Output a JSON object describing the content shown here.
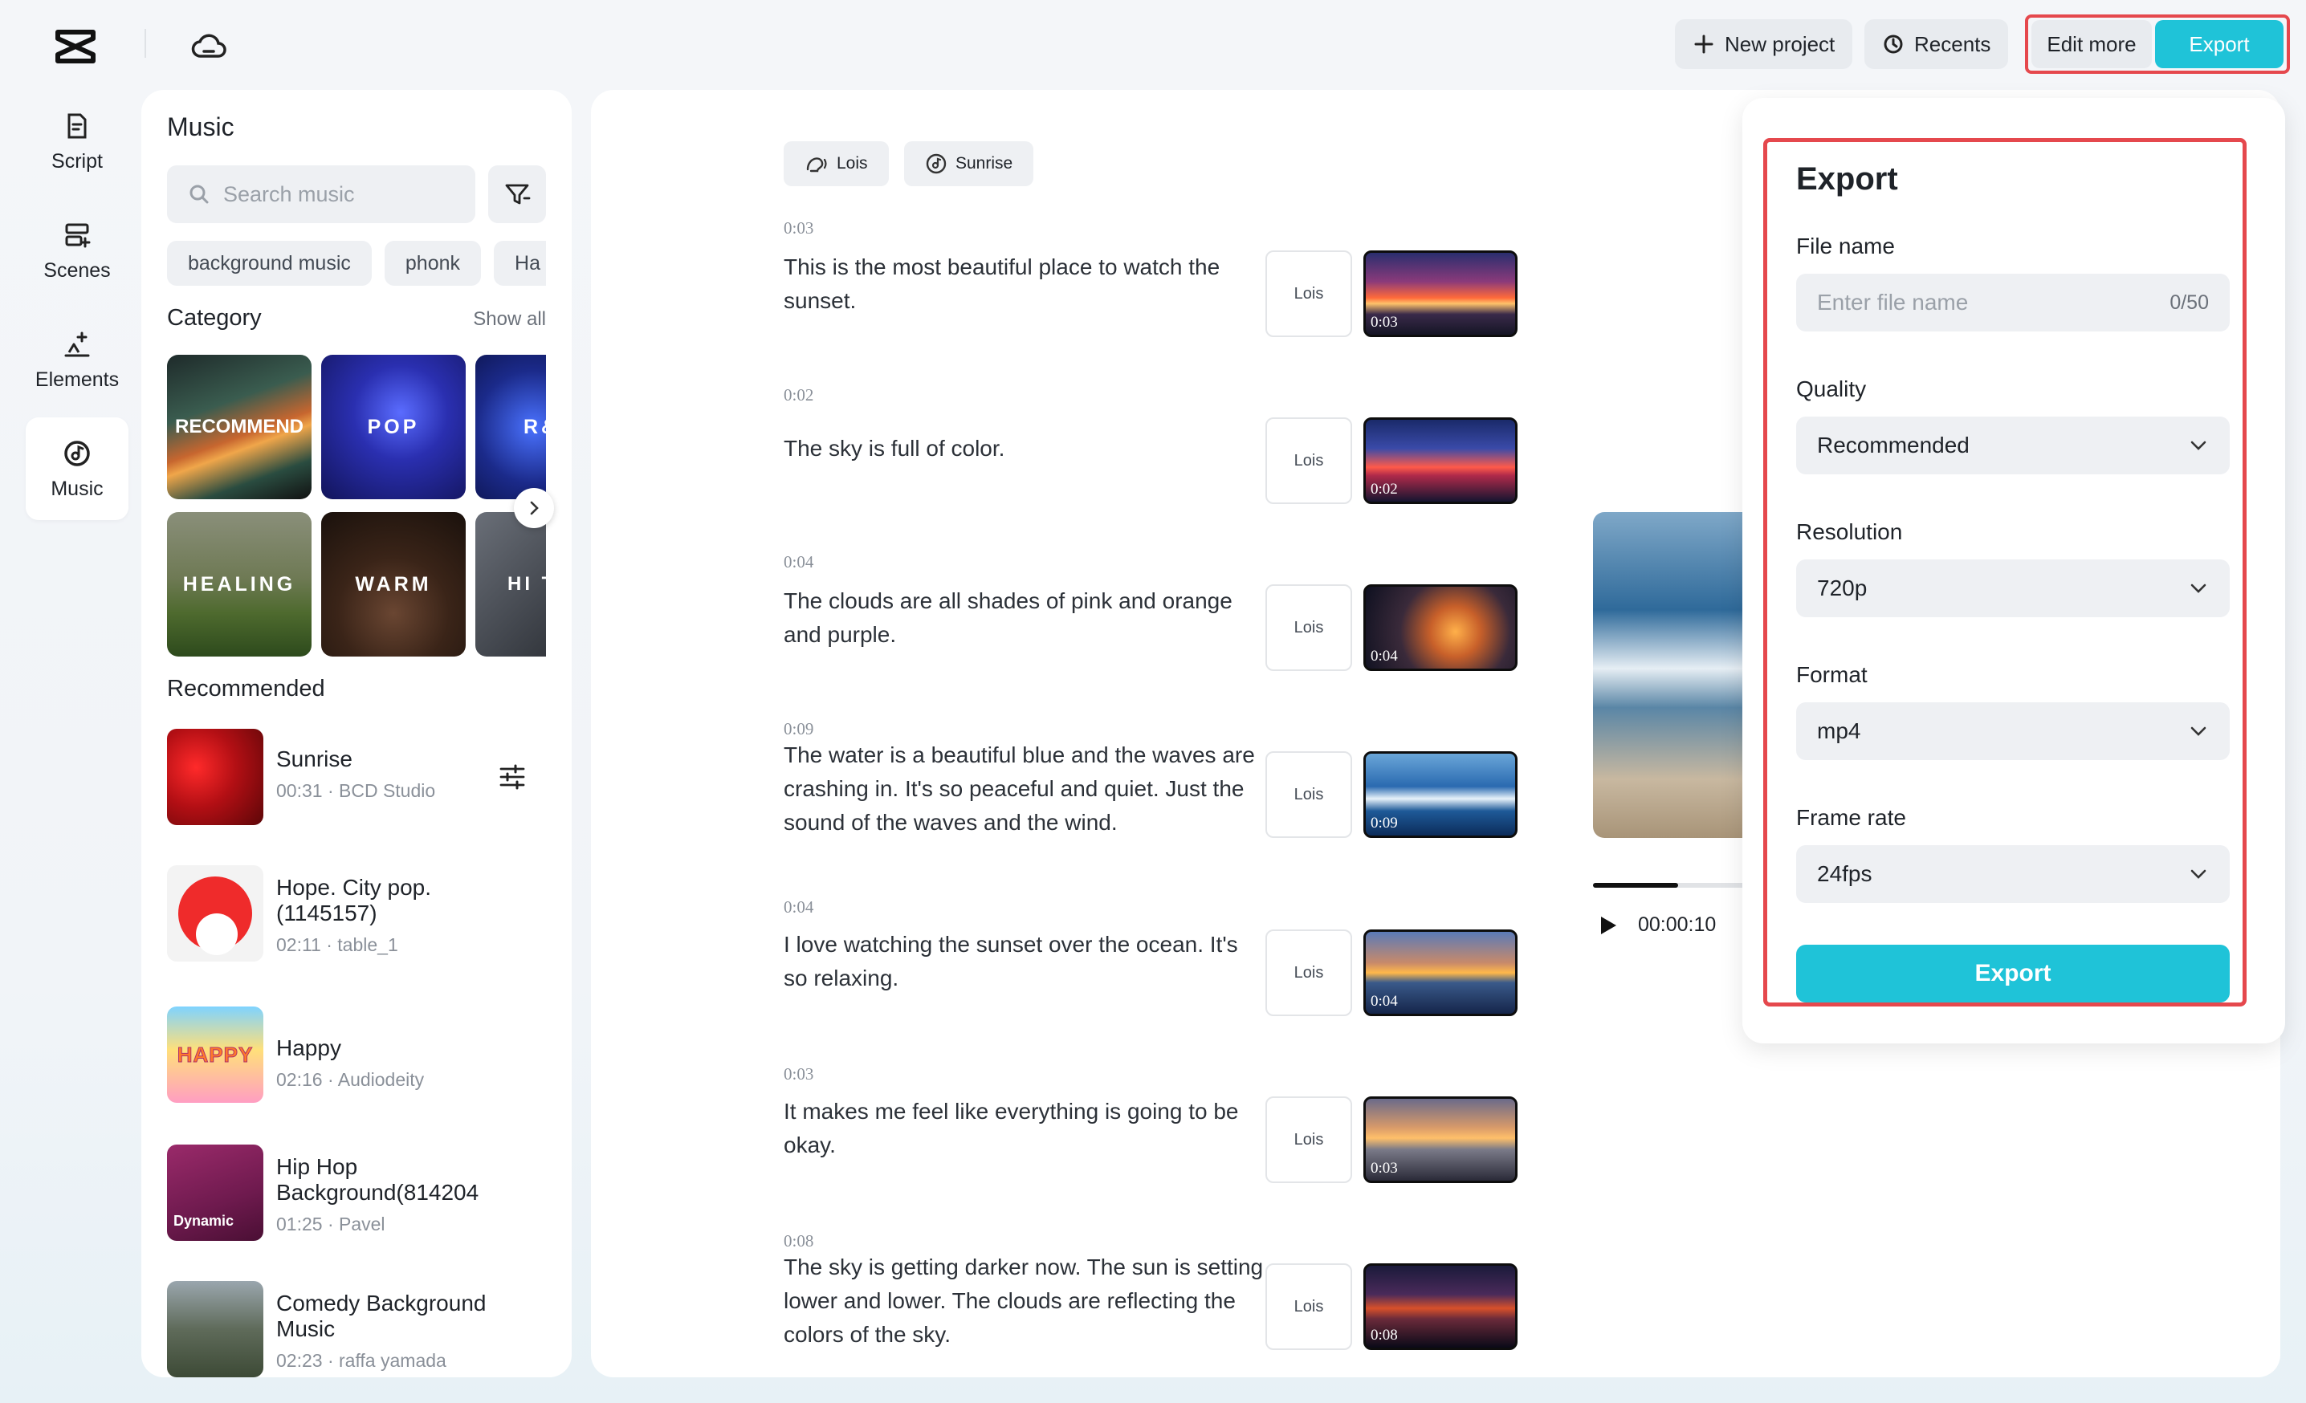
{
  "topbar": {
    "new_project": "New project",
    "recents": "Recents",
    "edit_more": "Edit more",
    "export": "Export"
  },
  "rail": [
    {
      "label": "Script",
      "icon": "script-icon"
    },
    {
      "label": "Scenes",
      "icon": "scenes-icon"
    },
    {
      "label": "Elements",
      "icon": "elements-icon"
    },
    {
      "label": "Music",
      "icon": "music-icon",
      "active": true
    }
  ],
  "music": {
    "title": "Music",
    "search_placeholder": "Search music",
    "chips": [
      "background music",
      "phonk",
      "Ha"
    ],
    "category_title": "Category",
    "show_all": "Show all",
    "categories": [
      "RECOMMEND",
      "POP",
      "R&",
      "HEALING",
      "WARM",
      "HI TEN"
    ],
    "recommended_title": "Recommended",
    "tracks": [
      {
        "name": "Sunrise",
        "meta": "00:31 · BCD Studio"
      },
      {
        "name": "Hope. City pop. (1145157)",
        "meta": "02:11 · table_1"
      },
      {
        "name": "Happy",
        "meta": "02:16 · Audiodeity"
      },
      {
        "name": "Hip Hop Background(814204",
        "meta": "01:25 · Pavel",
        "cover_text": "Dynamic"
      },
      {
        "name": "Comedy Background Music",
        "meta": "02:23 · raffa yamada"
      }
    ],
    "happy_cover_text": "HAPPY"
  },
  "script": {
    "voice_tag": "Lois",
    "music_tag": "Sunrise",
    "scenes": [
      {
        "time": "0:03",
        "text": "This is the most beautiful place to watch the sunset.",
        "voice": "Lois",
        "thumb_time": "0:03"
      },
      {
        "time": "0:02",
        "text": "The sky is full of color.",
        "voice": "Lois",
        "thumb_time": "0:02"
      },
      {
        "time": "0:04",
        "text": "The clouds are all shades of pink and orange and purple.",
        "voice": "Lois",
        "thumb_time": "0:04"
      },
      {
        "time": "0:09",
        "text": "The water is a beautiful blue and the waves are crashing in. It's so peaceful and quiet. Just the sound of the waves and the wind.",
        "voice": "Lois",
        "thumb_time": "0:09"
      },
      {
        "time": "0:04",
        "text": "I love watching the sunset over the ocean. It's so relaxing.",
        "voice": "Lois",
        "thumb_time": "0:04"
      },
      {
        "time": "0:03",
        "text": "It makes me feel like everything is going to be okay.",
        "voice": "Lois",
        "thumb_time": "0:03"
      },
      {
        "time": "0:08",
        "text": "The sky is getting darker now. The sun is setting lower and lower. The clouds are reflecting the colors of the sky.",
        "voice": "Lois",
        "thumb_time": "0:08"
      }
    ]
  },
  "player": {
    "timecode": "00:00:10",
    "progress": 0.56
  },
  "export_panel": {
    "title": "Export",
    "file_name_label": "File name",
    "file_name_placeholder": "Enter file name",
    "file_name_count": "0/50",
    "quality_label": "Quality",
    "quality_value": "Recommended",
    "resolution_label": "Resolution",
    "resolution_value": "720p",
    "format_label": "Format",
    "format_value": "mp4",
    "frame_rate_label": "Frame rate",
    "frame_rate_value": "24fps",
    "export_button": "Export"
  },
  "colors": {
    "accent": "#1fc3d8",
    "highlight_border": "#e5484d"
  }
}
